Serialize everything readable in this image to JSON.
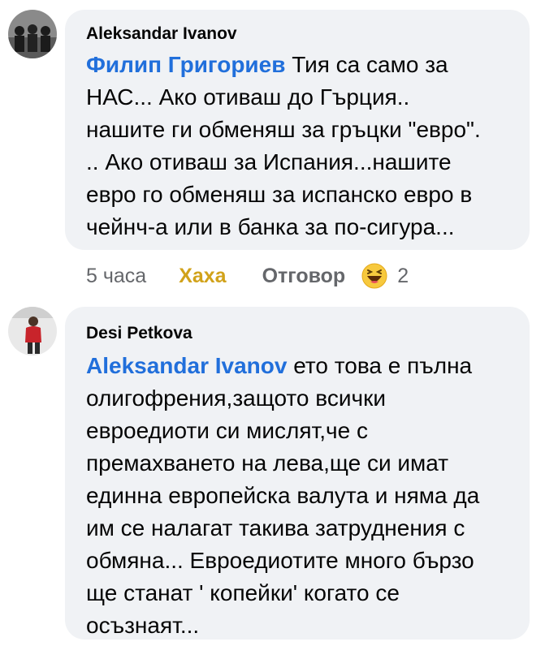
{
  "comments": [
    {
      "author": "Aleksandar Ivanov",
      "mention": "Филип Григориев",
      "text": " Тия са само за\nНАС... Ако отиваш до Гърция..\nнашите ги обменяш за гръцки \"евро\".\n.. Ако отиваш за Испания...нашите\nевро го обменяш за испанско евро в\nчейнч-а или в банка за по-сигура...",
      "actions": {
        "time": "5 часа",
        "like": "Хаха",
        "reply": "Отговор",
        "reaction_icon": "haha-emoji-icon",
        "reaction_count": "2"
      }
    },
    {
      "author": "Desi Petkova",
      "mention": "Aleksandar Ivanov",
      "text": " ето това е пълна\nолигофрения,защото всички\nевроедиоти си мислят,че с\nпремахването на лева,ще си имат\nединна европейска валута и няма да\nим се налагат такива затруднения с\nобмяна... Евроедиотите много бързо\nще станат ' копейки' когато се\nосъзнаят..."
    }
  ],
  "colors": {
    "bubble": "#f0f2f5",
    "mention": "#216fdb",
    "like_active": "#d1a21a",
    "meta": "#65676b"
  }
}
